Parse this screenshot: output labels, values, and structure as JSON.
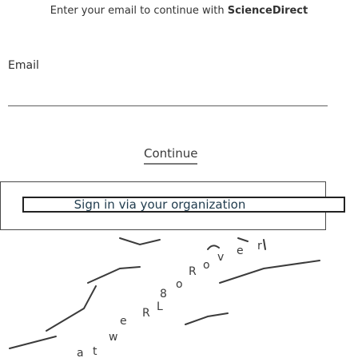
{
  "header": {
    "prompt_text": "Enter your email to continue with ",
    "brand_name": "ScienceDirect"
  },
  "form": {
    "email_label": "Email",
    "email_value": "",
    "continue_label": "Continue"
  },
  "organization": {
    "sign_in_label": "Sign in via your organization"
  },
  "decoration": {
    "icon": "scribble-illustration",
    "ink_color": "#3b3b3b"
  }
}
